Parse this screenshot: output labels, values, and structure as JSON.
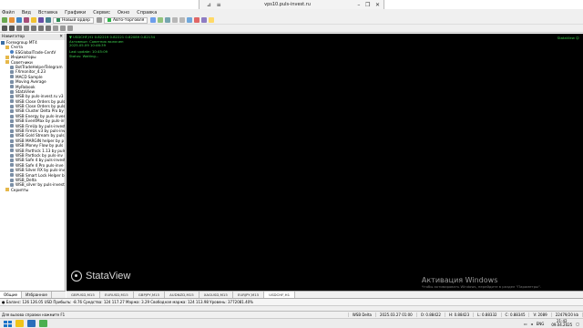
{
  "remote": {
    "title": "vps10.puls-invest.ru"
  },
  "menu": [
    "Файл",
    "Вид",
    "Вставка",
    "Графики",
    "Сервис",
    "Окно",
    "Справка"
  ],
  "toolbar": {
    "new_order": "Новый ордер",
    "auto_trading": "Авто-торговля"
  },
  "navigator": {
    "title": "Навигатор",
    "nodes": [
      {
        "label": "Forexgroup MT4",
        "level": 0,
        "icon": "terminal"
      },
      {
        "label": "Счета",
        "level": 1,
        "icon": "folder"
      },
      {
        "label": "ESGlobalTrade-CentV",
        "level": 2,
        "icon": "user"
      },
      {
        "label": "Индикаторы",
        "level": 1,
        "icon": "folder"
      },
      {
        "label": "Советники",
        "level": 1,
        "icon": "folder"
      },
      {
        "label": "BotTradeHelperTelegram",
        "level": 2,
        "icon": "ea"
      },
      {
        "label": "FXmonitor_4.23",
        "level": 2,
        "icon": "ea"
      },
      {
        "label": "MACD Sample",
        "level": 2,
        "icon": "ea"
      },
      {
        "label": "Moving Average",
        "level": 2,
        "icon": "ea"
      },
      {
        "label": "MyRobook",
        "level": 2,
        "icon": "ea"
      },
      {
        "label": "StataView",
        "level": 2,
        "icon": "ea"
      },
      {
        "label": "WSB by puls-invest.ru v3",
        "level": 2,
        "icon": "ea"
      },
      {
        "label": "WSB Close Orders by puls",
        "level": 2,
        "icon": "ea"
      },
      {
        "label": "WSB Close Orders by puls",
        "level": 2,
        "icon": "ea"
      },
      {
        "label": "WSB Cluster Delta Pro by",
        "level": 2,
        "icon": "ea"
      },
      {
        "label": "WSB Energy by puls-inves",
        "level": 2,
        "icon": "ea"
      },
      {
        "label": "WSB EventMax by puls-inv",
        "level": 2,
        "icon": "ea"
      },
      {
        "label": "WSB FireUp by puls-invest",
        "level": 2,
        "icon": "ea"
      },
      {
        "label": "WSB FireUs v3 by puls-inv",
        "level": 2,
        "icon": "ea"
      },
      {
        "label": "WSB Gold Stream by puls",
        "level": 2,
        "icon": "ea"
      },
      {
        "label": "WSB MARGIN helper by p",
        "level": 2,
        "icon": "ea"
      },
      {
        "label": "WSB Money Flow by puls",
        "level": 2,
        "icon": "ea"
      },
      {
        "label": "WSB Parthick 1.13 by puls",
        "level": 2,
        "icon": "ea"
      },
      {
        "label": "WSB Partlock by puls-inv",
        "level": 2,
        "icon": "ea"
      },
      {
        "label": "WSB Safe 4 by puls-invest",
        "level": 2,
        "icon": "ea"
      },
      {
        "label": "WSB Safe 4 Pro puls-inve",
        "level": 2,
        "icon": "ea"
      },
      {
        "label": "WSB Silver RX by puls-inv",
        "level": 2,
        "icon": "ea"
      },
      {
        "label": "WSB Smart Lock Helper b",
        "level": 2,
        "icon": "ea"
      },
      {
        "label": "WSB_Delta",
        "level": 2,
        "icon": "ea"
      },
      {
        "label": "WSB_silver by puls-invest",
        "level": 2,
        "icon": "ea"
      },
      {
        "label": "Скрипты",
        "level": 1,
        "icon": "folder"
      }
    ],
    "tabs": [
      "Общие",
      "Избранное"
    ]
  },
  "chart": {
    "header_line1": "▼ USDCHF,H1  0.82219 0.82221 0.82089 0.82134",
    "header_line2": "Активные: Советник включен",
    "header_line3": "        2025.05.09 10:46:39",
    "header_line4": "Last update: 10:45:09",
    "header_line5": "Status: Waiting...",
    "right_label": "StataView ☺",
    "watermark": "StataView",
    "activation_title": "Активация Windows",
    "activation_sub": "Чтобы активировать Windows, перейдите в раздел \"Параметры\"."
  },
  "symbol_tabs": [
    "GBPUSD,M15",
    "EURUSD,M15",
    "GBPJPY,M15",
    "AUDNZD,M15",
    "XAGUSD,M15",
    "EURJPY,M15",
    "USDCHF,H1"
  ],
  "symbol_tab_active": 6,
  "terminal": {
    "balance_line": "● Баланс: 126 126.05 USD  Прибыль: -8.76  Средства: 124 117.27  Маржа: 3.29  Свободная маржа: 124 113.98  Уровень: 3772081.40%"
  },
  "status": {
    "help": "Для вызова справки нажмите F1",
    "profile": "WSB Delta",
    "datetime": "2025.03.27 01:00",
    "o": "O: 0.88422",
    "h": "H: 0.88423",
    "l": "L: 0.88332",
    "c": "C: 0.88345",
    "v": "V: 2089",
    "traffic": "22479/20 kb"
  },
  "taskbar": {
    "lang": "ENG",
    "time": "21:42",
    "date": "09.04.2025"
  }
}
